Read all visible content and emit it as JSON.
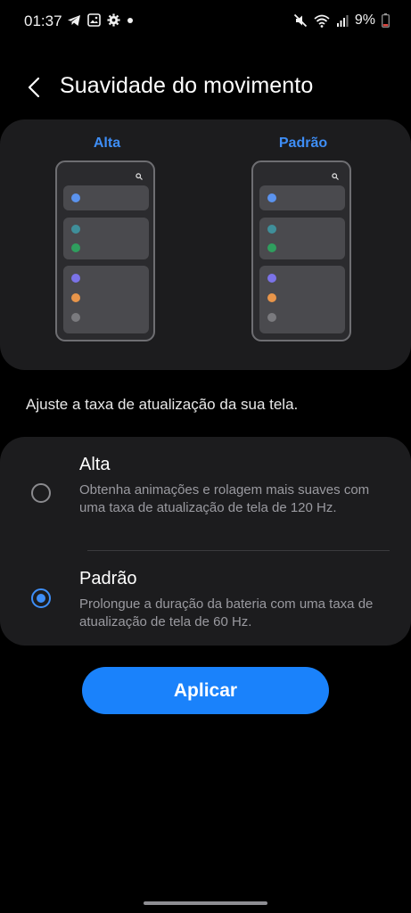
{
  "status_bar": {
    "time": "01:37",
    "left_icons": [
      "telegram-icon",
      "gallery-icon",
      "settings-icon",
      "notification-dot-icon"
    ],
    "right_icons": [
      "mute-icon",
      "wifi-icon",
      "signal-icon",
      "battery-icon"
    ],
    "battery_text": "9%"
  },
  "header": {
    "title": "Suavidade do movimento",
    "back_icon": "chevron-left-icon"
  },
  "preview": {
    "left_label": "Alta",
    "right_label": "Padrão"
  },
  "instruction": "Ajuste a taxa de atualização da sua tela.",
  "options": [
    {
      "title": "Alta",
      "description": "Obtenha animações e rolagem mais suaves com uma taxa de atualização de tela de 120 Hz.",
      "selected": false
    },
    {
      "title": "Padrão",
      "description": "Prolongue a duração da bateria com uma taxa de atualização de tela de 60 Hz.",
      "selected": true
    }
  ],
  "apply_button": "Aplicar",
  "colors": {
    "accent": "#3e8ef7",
    "button": "#1a82fb",
    "card": "#1c1c1e",
    "background": "#000000",
    "dot_blue": "#5b93ee",
    "dot_teal": "#3f8f9a",
    "dot_green": "#2f9e5e",
    "dot_purple": "#7b73e8",
    "dot_orange": "#e8954a",
    "dot_gray": "#7a7a7e"
  }
}
